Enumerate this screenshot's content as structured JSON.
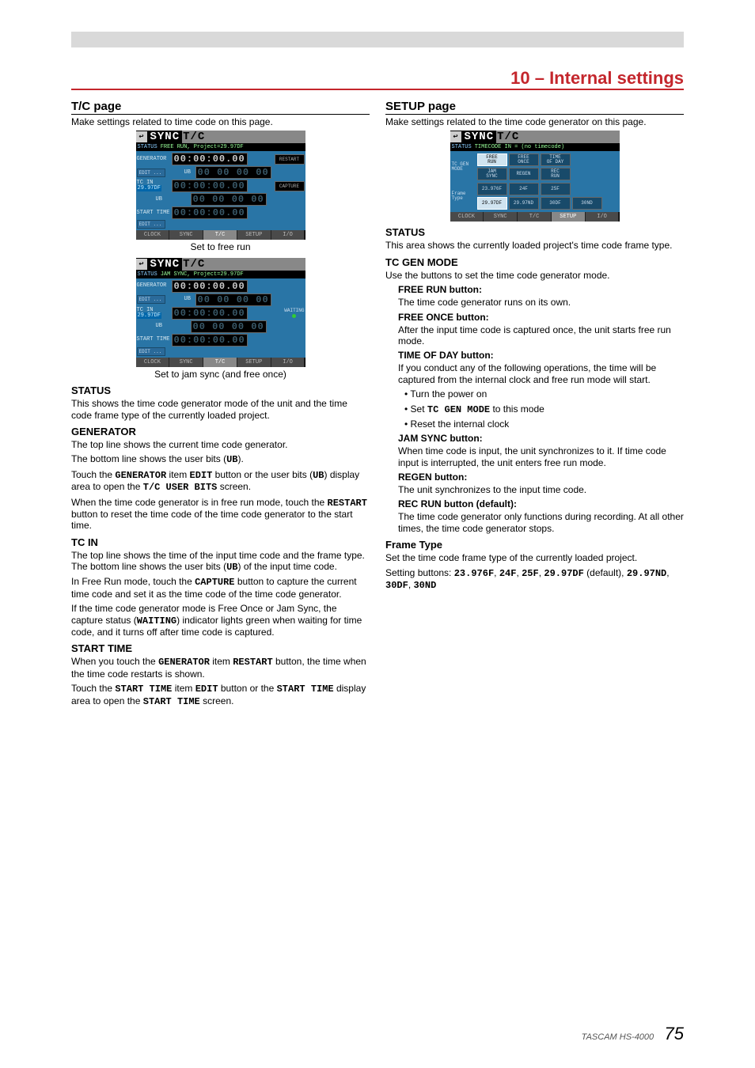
{
  "chapter": "10 – Internal settings",
  "footer_model": "TASCAM HS-4000",
  "footer_page": "75",
  "left": {
    "h_tc": "T/C page",
    "intro": "Make settings related to time code on this page.",
    "cap1": "Set to free run",
    "cap2": "Set to jam sync (and free once)",
    "h_status": "STATUS",
    "p_status": "This shows the time code generator mode of the unit and the time code frame type of the currently loaded project.",
    "h_gen": "GENERATOR",
    "p_gen1": "The top line shows the current time code generator.",
    "p_gen2a": "The bottom line shows the user bits (",
    "p_gen2b": ").",
    "p_gen3a": "Touch the ",
    "p_gen3b": " item ",
    "p_gen3c": " button or the user bits (",
    "p_gen3d": ") display area to open the ",
    "p_gen3e": " screen.",
    "p_gen4a": "When the time code generator is in free run mode, touch the ",
    "p_gen4b": " button to reset the time code of the time code generator to the start time.",
    "h_tcin": "TC IN",
    "p_tcin1": "The top line shows the time of the input time code and the frame type. The bottom line shows the user bits (",
    "p_tcin1b": ") of the input time code.",
    "p_tcin2a": "In Free Run mode, touch the ",
    "p_tcin2b": " button to capture the current time code and set it as the time code of the time code generator.",
    "p_tcin3a": "If the time code generator mode is Free Once or Jam Sync, the capture status (",
    "p_tcin3b": ") indicator lights green when waiting for time code, and it turns off after time code is captured.",
    "h_start": "START TIME",
    "p_start1a": "When you touch the ",
    "p_start1b": " item ",
    "p_start1c": " button, the time when the time code restarts is shown.",
    "p_start2a": "Touch the ",
    "p_start2b": " item ",
    "p_start2c": " button or the ",
    "p_start2d": " display area to open the ",
    "p_start2e": " screen.",
    "mono": {
      "UB": "UB",
      "GENERATOR": "GENERATOR",
      "EDIT": "EDIT",
      "TC_USER_BITS": "T/C USER BITS",
      "RESTART": "RESTART",
      "CAPTURE": "CAPTURE",
      "WAITING": "WAITING",
      "START_TIME": "START TIME"
    },
    "shot": {
      "title_sync": "SYNC",
      "title_tc": "T/C",
      "status_k": "STATUS",
      "status_free": "FREE RUN, Project=29.97DF",
      "status_jam": "JAM SYNC, Project=29.97DF",
      "gen_lbl": "GENERATOR",
      "lcd_zero": "00:00:00.00",
      "restart": "RESTART",
      "edit": "EDIT ...",
      "ub": "UB",
      "ub_lcd": "00 00 00 00",
      "tcin_lbl1": "TC IN",
      "tcin_lbl2": "29.97DF",
      "capture": "CAPTURE",
      "waiting": "WAITING",
      "start_lbl": "START TIME",
      "tabs": {
        "clock": "CLOCK",
        "sync": "SYNC",
        "tc": "T/C",
        "setup": "SETUP",
        "io": "I/O"
      }
    }
  },
  "right": {
    "h_setup": "SETUP page",
    "intro": "Make settings related to the time code generator on this page.",
    "h_status": "STATUS",
    "p_status": "This area shows the currently loaded project's time code frame type.",
    "h_mode": "TC GEN MODE",
    "p_mode": "Use the buttons to set the time code generator mode.",
    "h_free": "FREE RUN button:",
    "p_free": "The time code generator runs on its own.",
    "h_once": "FREE ONCE button:",
    "p_once": "After the input time code is captured once, the unit starts free run mode.",
    "h_tod": "TIME OF DAY button:",
    "p_tod": "If you conduct any of the following operations, the time will be captured from the internal clock and free run mode will start.",
    "b1": "• Turn the power on",
    "b2a": "• Set ",
    "b2b": " to this mode",
    "b3": "• Reset the internal clock",
    "h_jam": "JAM SYNC button:",
    "p_jam": "When time code is input, the unit synchronizes to it. If time code input is interrupted, the unit enters free run mode.",
    "h_regen": "REGEN button:",
    "p_regen": "The unit synchronizes to the input time code.",
    "h_rec": "REC RUN button (default):",
    "p_rec": "The time code generator only functions during recording. At all other times, the time code generator stops.",
    "h_ft": "Frame Type",
    "p_ft1": "Set the time code frame type of the currently loaded project.",
    "p_ft2a": "Setting buttons: ",
    "p_ft2b": " (default), ",
    "mono": {
      "TC_GEN_MODE": "TC GEN MODE",
      "f1": "23.976F",
      "f2": "24F",
      "f3": "25F",
      "f4": "29.97DF",
      "f5": "29.97ND",
      "f6": "30DF",
      "f7": "30ND"
    },
    "shot": {
      "status_line": "TIMECODE IN = (no timecode)",
      "mode_lbl": "TC GEN\nMODE",
      "btns": {
        "free_run": "FREE\nRUN",
        "free_once": "FREE\nONCE",
        "tod": "TIME\nOF DAY",
        "jam": "JAM\nSYNC",
        "regen": "REGEN",
        "rec": "REC\nRUN"
      },
      "ft_lbl": "Frame\nType",
      "ft": {
        "a": "23.976F",
        "b": "24F",
        "c": "25F",
        "d": "",
        "e": "29.97DF",
        "f": "29.97ND",
        "g": "30DF",
        "h": "30ND"
      }
    }
  }
}
